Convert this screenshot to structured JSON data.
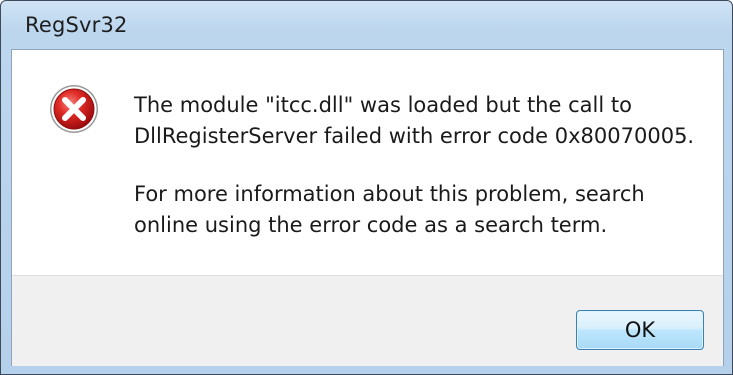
{
  "window": {
    "title": "RegSvr32"
  },
  "message": {
    "line1": "The module \"itcc.dll\" was loaded but the call to DllRegisterServer failed with error code 0x80070005.",
    "line2": "For more information about this problem, search online using the error code as a search term."
  },
  "buttons": {
    "ok_label": "OK"
  },
  "icon": {
    "name": "error-icon",
    "color": "#c8151b"
  }
}
